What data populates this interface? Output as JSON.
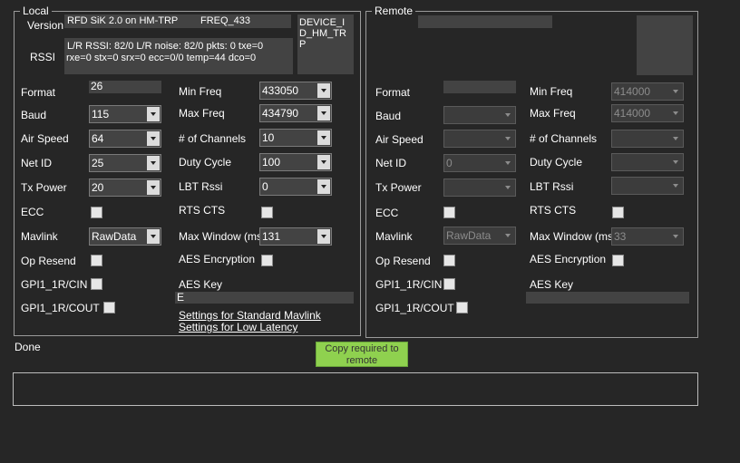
{
  "local": {
    "legend": "Local",
    "version_label": "Version",
    "version_value": "RFD SiK 2.0 on HM-TRP",
    "freq_value": "FREQ_433",
    "device_id_value": "DEVICE_ID_HM_TRP",
    "rssi_label": "RSSI",
    "rssi_line1": "L/R RSSI: 82/0  L/R noise: 82/0 pkts: 0  txe=0",
    "rssi_line2": "rxe=0 stx=0 srx=0 ecc=0/0 temp=44 dco=0",
    "labels": {
      "format": "Format",
      "baud": "Baud",
      "air_speed": "Air Speed",
      "net_id": "Net ID",
      "tx_power": "Tx Power",
      "ecc": "ECC",
      "mavlink": "Mavlink",
      "op_resend": "Op Resend",
      "gpi_cin": "GPI1_1R/CIN",
      "gpi_cout": "GPI1_1R/COUT",
      "min_freq": "Min Freq",
      "max_freq": "Max Freq",
      "channels": "# of Channels",
      "duty_cycle": "Duty Cycle",
      "lbt_rssi": "LBT Rssi",
      "rts_cts": "RTS CTS",
      "max_window": "Max Window (ms)",
      "aes_encryption": "AES Encryption",
      "aes_key": "AES Key"
    },
    "values": {
      "format": "26",
      "baud": "115",
      "air_speed": "64",
      "net_id": "25",
      "tx_power": "20",
      "mavlink": "RawData",
      "min_freq": "433050",
      "max_freq": "434790",
      "channels": "10",
      "duty_cycle": "100",
      "lbt_rssi": "0",
      "max_window": "131",
      "aes_key": "E"
    },
    "checkboxes": {
      "ecc": false,
      "op_resend": false,
      "gpi_cin": false,
      "gpi_cout": false,
      "rts_cts": false,
      "aes_encryption": false
    },
    "link_standard": "Settings for Standard Mavlink",
    "link_low_latency": "Settings for Low Latency"
  },
  "remote": {
    "legend": "Remote",
    "labels": {
      "format": "Format",
      "baud": "Baud",
      "air_speed": "Air Speed",
      "net_id": "Net ID",
      "tx_power": "Tx Power",
      "ecc": "ECC",
      "mavlink": "Mavlink",
      "op_resend": "Op Resend",
      "gpi_cin": "GPI1_1R/CIN",
      "gpi_cout": "GPI1_1R/COUT",
      "min_freq": "Min Freq",
      "max_freq": "Max Freq",
      "channels": "# of Channels",
      "duty_cycle": "Duty Cycle",
      "lbt_rssi": "LBT Rssi",
      "rts_cts": "RTS CTS",
      "max_window": "Max Window (ms)",
      "aes_encryption": "AES Encryption",
      "aes_key": "AES Key"
    },
    "values": {
      "format": "",
      "baud": "",
      "air_speed": "",
      "net_id": "0",
      "tx_power": "",
      "mavlink": "RawData",
      "min_freq": "414000",
      "max_freq": "414000",
      "channels": "",
      "duty_cycle": "",
      "lbt_rssi": "",
      "max_window": "33",
      "aes_key": ""
    }
  },
  "status": "Done",
  "copy_button": "Copy required to remote",
  "colors": {
    "background": "#262626",
    "field": "#434343",
    "button_green": "#8fd14f"
  }
}
